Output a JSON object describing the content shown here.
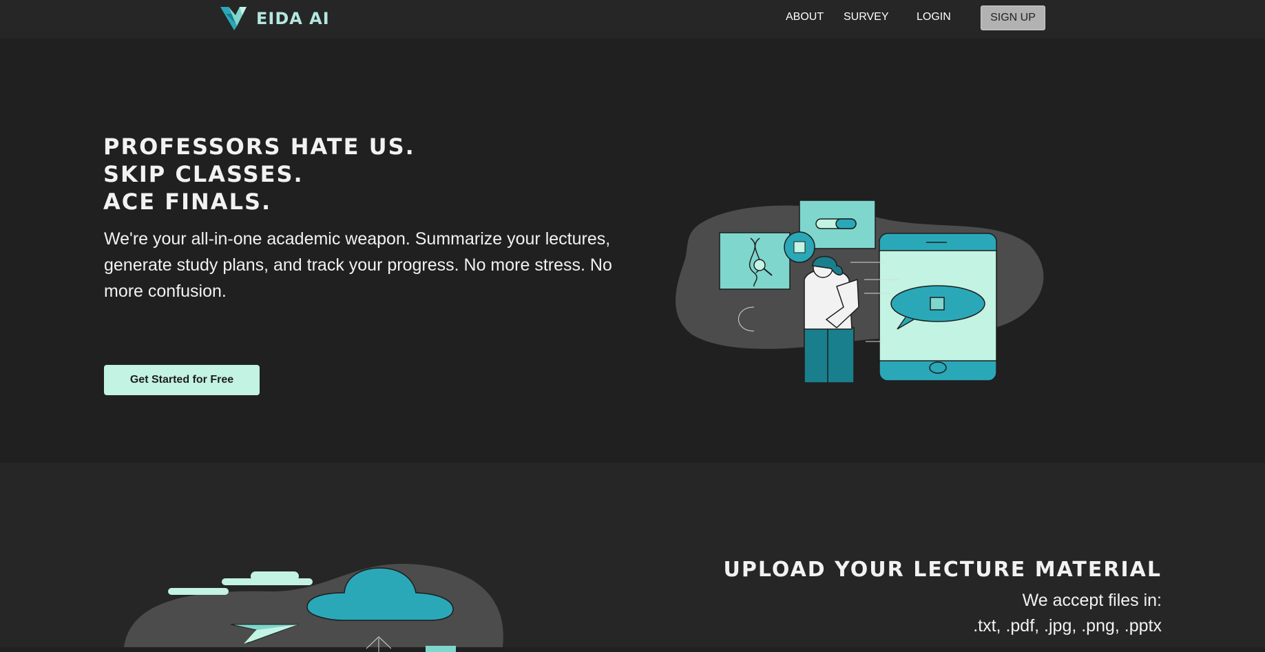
{
  "header": {
    "brand": "EIDA AI",
    "nav": {
      "about": "ABOUT",
      "survey": "SURVEY",
      "login": "LOGIN",
      "signup": "SIGN UP"
    }
  },
  "hero": {
    "headline": [
      "PROFESSORS HATE US.",
      "SKIP CLASSES.",
      "ACE FINALS."
    ],
    "lead": "We're your all-in-one academic weapon. Summarize your lectures, generate study plans, and track your progress. No more stress. No more confusion.",
    "cta": "Get Started for Free"
  },
  "upload_section": {
    "title": "UPLOAD YOUR LECTURE MATERIAL",
    "accept_label": "We accept files in:",
    "formats": ".txt, .pdf, .jpg, .png, .pptx"
  },
  "icons": {
    "logo": "veida-logo-icon",
    "hero_illustration": "student-with-phone-illustration",
    "upload_illustration": "cloud-upload-illustration"
  },
  "colors": {
    "background": "#202020",
    "navbar": "#262626",
    "accent_mint": "#c3f3e2",
    "accent_teal": "#2aa8b8",
    "blob_grey": "#4c4c4c"
  }
}
